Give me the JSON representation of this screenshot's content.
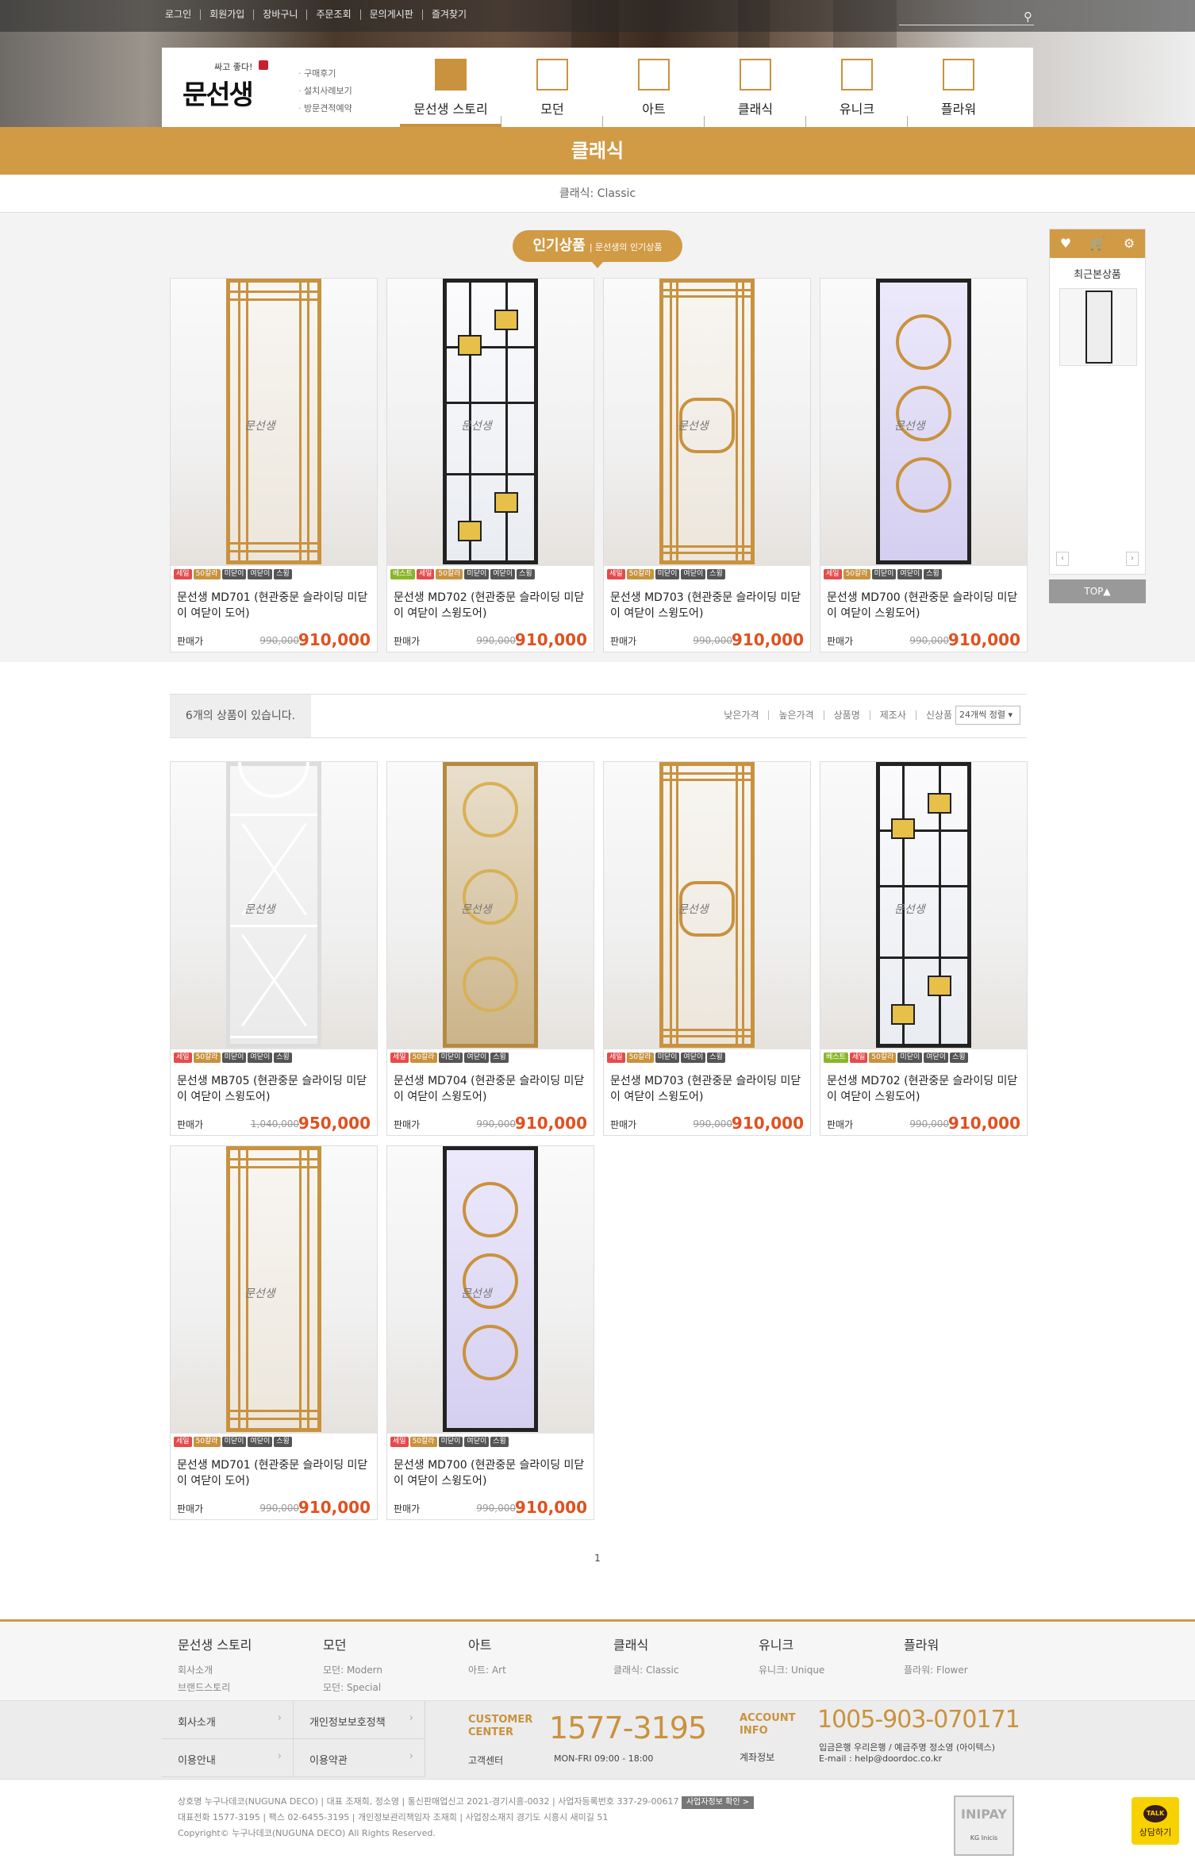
{
  "top_links": [
    "로그인",
    "회원가입",
    "장바구니",
    "주문조회",
    "문의게시판",
    "즐겨찾기"
  ],
  "logo": {
    "slogan": "싸고 좋다!",
    "name": "문선생"
  },
  "sub_links": [
    "구매후기",
    "설치사례보기",
    "방문견적예약"
  ],
  "menu": [
    "문선생 스토리",
    "모던",
    "아트",
    "클래식",
    "유니크",
    "플라워"
  ],
  "category_title": "클래식",
  "category_sub": "클래식: Classic",
  "popular": {
    "badge": "인기상품",
    "sub": "| 문선생의 인기상품"
  },
  "side": {
    "title": "최근본상품",
    "top": "TOP▲",
    "prev": "‹",
    "next": "›"
  },
  "price_label": "판매가",
  "popular_products": [
    {
      "name": "문선생 MD701 (현관중문 슬라이딩 미닫이 여닫이 도어)",
      "old": "990,000",
      "price": "910,000",
      "tags": [
        "세일",
        "50칼라",
        "미닫이",
        "여닫이",
        "스윙"
      ]
    },
    {
      "name": "문선생 MD702 (현관중문 슬라이딩 미닫이 여닫이 스윙도어)",
      "old": "990,000",
      "price": "910,000",
      "tags": [
        "베스트",
        "세일",
        "50칼라",
        "미닫이",
        "여닫이",
        "스윙"
      ]
    },
    {
      "name": "문선생 MD703 (현관중문 슬라이딩 미닫이 여닫이 스윙도어)",
      "old": "990,000",
      "price": "910,000",
      "tags": [
        "세일",
        "50칼라",
        "미닫이",
        "여닫이",
        "스윙"
      ]
    },
    {
      "name": "문선생 MD700 (현관중문 슬라이딩 미닫이 여닫이 스윙도어)",
      "old": "990,000",
      "price": "910,000",
      "tags": [
        "세일",
        "50칼라",
        "미닫이",
        "여닫이",
        "스윙"
      ]
    }
  ],
  "list": {
    "count_text": "6개의 상품이 있습니다.",
    "sorts": [
      "낮은가격",
      "높은가격",
      "상품명",
      "제조사",
      "신상품"
    ],
    "select": "24개씩 정렬"
  },
  "products": [
    {
      "name": "문선생 MB705 (현관중문 슬라이딩 미닫이 여닫이 스윙도어)",
      "old": "1,040,000",
      "price": "950,000",
      "tags": [
        "세일",
        "50칼라",
        "미닫이",
        "여닫이",
        "스윙"
      ]
    },
    {
      "name": "문선생 MD704 (현관중문 슬라이딩 미닫이 여닫이 스윙도어)",
      "old": "990,000",
      "price": "910,000",
      "tags": [
        "세일",
        "50칼라",
        "미닫이",
        "여닫이",
        "스윙"
      ]
    },
    {
      "name": "문선생 MD703 (현관중문 슬라이딩 미닫이 여닫이 스윙도어)",
      "old": "990,000",
      "price": "910,000",
      "tags": [
        "세일",
        "50칼라",
        "미닫이",
        "여닫이",
        "스윙"
      ]
    },
    {
      "name": "문선생 MD702 (현관중문 슬라이딩 미닫이 여닫이 스윙도어)",
      "old": "990,000",
      "price": "910,000",
      "tags": [
        "베스트",
        "세일",
        "50칼라",
        "미닫이",
        "여닫이",
        "스윙"
      ]
    },
    {
      "name": "문선생 MD701 (현관중문 슬라이딩 미닫이 여닫이 도어)",
      "old": "990,000",
      "price": "910,000",
      "tags": [
        "세일",
        "50칼라",
        "미닫이",
        "여닫이",
        "스윙"
      ]
    },
    {
      "name": "문선생 MD700 (현관중문 슬라이딩 미닫이 여닫이 스윙도어)",
      "old": "990,000",
      "price": "910,000",
      "tags": [
        "세일",
        "50칼라",
        "미닫이",
        "여닫이",
        "스윙"
      ]
    }
  ],
  "pager": "1",
  "footer_nav": [
    {
      "title": "문선생 스토리",
      "items": [
        "회사소개",
        "브랜드스토리"
      ]
    },
    {
      "title": "모던",
      "items": [
        "모던: Modern",
        "모던: Special"
      ]
    },
    {
      "title": "아트",
      "items": [
        "아트: Art"
      ]
    },
    {
      "title": "클래식",
      "items": [
        "클래식: Classic"
      ]
    },
    {
      "title": "유니크",
      "items": [
        "유니크: Unique"
      ]
    },
    {
      "title": "플라워",
      "items": [
        "플라워: Flower"
      ]
    }
  ],
  "footer_links": [
    "회사소개",
    "개인정보보호정책",
    "이용안내",
    "이용약관"
  ],
  "customer": {
    "label1": "CUSTOMER",
    "label2": "CENTER",
    "sub": "고객센터",
    "phone": "1577-3195",
    "hours": "MON-FRI 09:00 - 18:00"
  },
  "account": {
    "label1": "ACCOUNT",
    "label2": "INFO",
    "sub": "계좌정보",
    "number": "1005-903-070171",
    "bank": "입금은행 우리은행 / 예금주명 정소영 (아이텍스)",
    "email": "E-mail : help@doordoc.co.kr"
  },
  "copyright": [
    "상호명 누구나데코(NUGUNA DECO) | 대표 조재희, 정소영 | 통신판매업신고 2021-경기시흥-0032 | 사업자등록번호 337-29-00617",
    "대표전화 1577-3195 | 팩스 02-6455-3195 | 개인정보관리책임자 조재희 | 사업장소재지 경기도 시흥시 새미길 51",
    "Copyright© 누구나데코(NUGUNA DECO) All Rights Reserved."
  ],
  "biz_check": "사업자정보 확인 >",
  "inipay": {
    "label": "INIPAY",
    "sub": "KG Inicis"
  },
  "kakao": {
    "bubble": "TALK",
    "label": "상담하기"
  }
}
